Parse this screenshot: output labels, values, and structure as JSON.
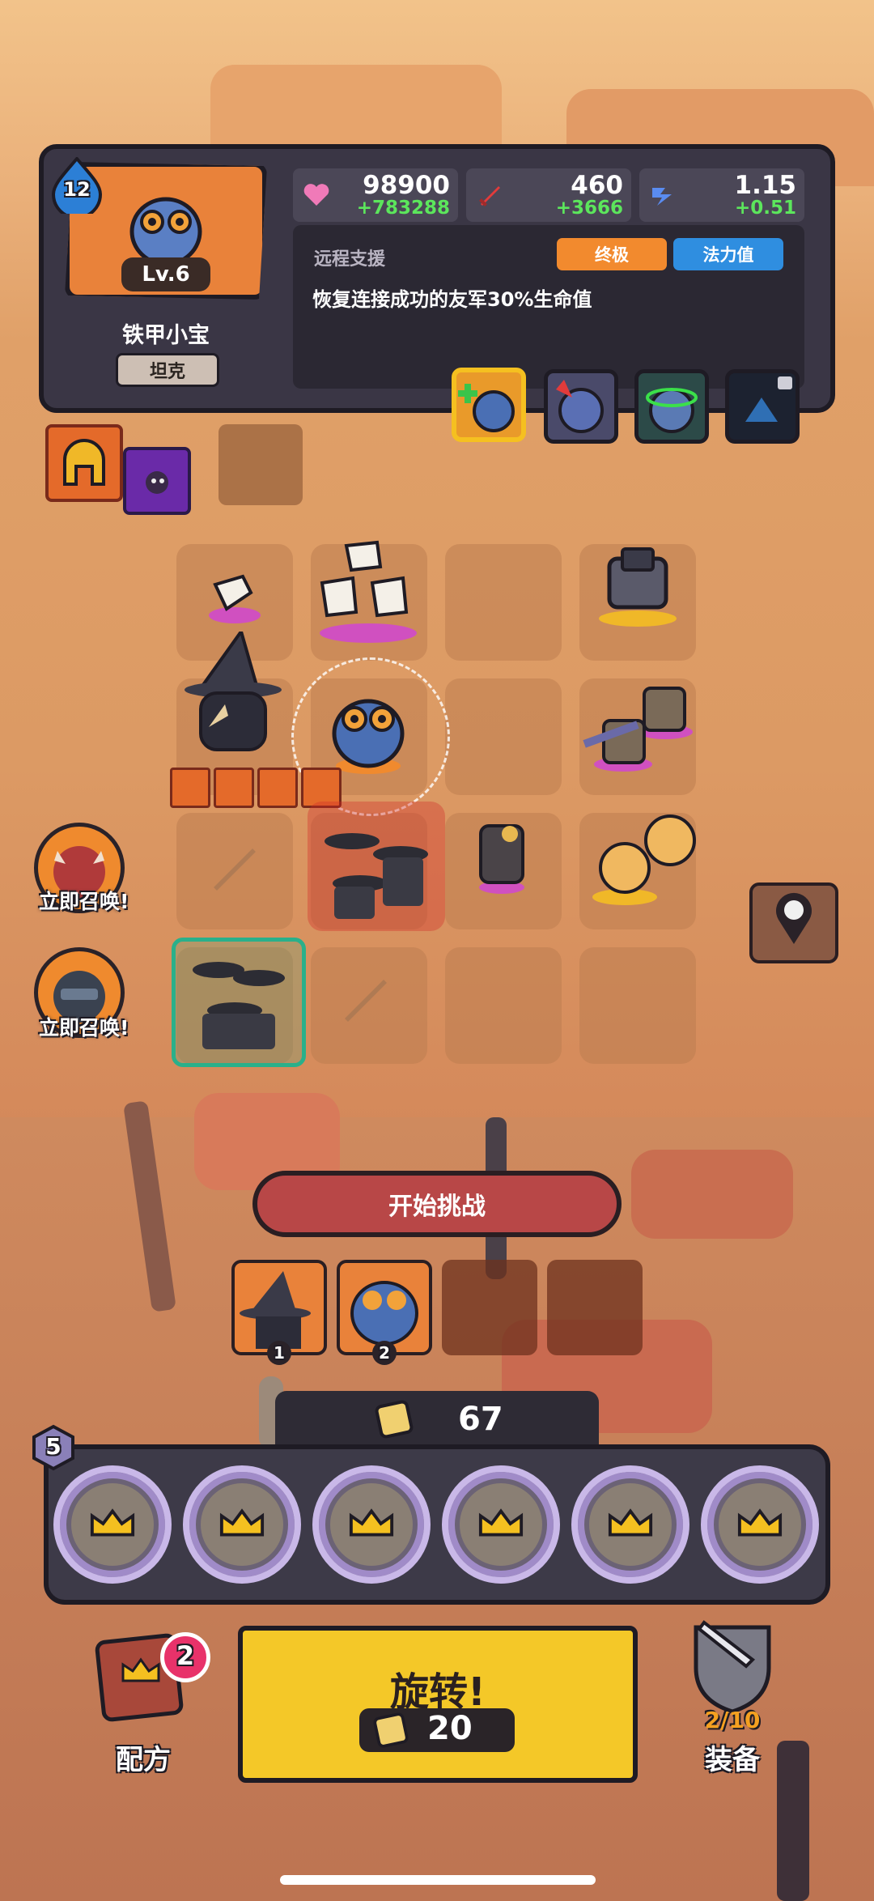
{
  "hero": {
    "star_level": "12",
    "level": "Lv.6",
    "name": "铁甲小宝",
    "role": "坦克"
  },
  "stats": {
    "hp": {
      "value": "98900",
      "delta": "+783288",
      "icon": "heart-icon"
    },
    "attack": {
      "value": "460",
      "delta": "+3666",
      "icon": "sword-icon"
    },
    "speed": {
      "value": "1.15",
      "delta": "+0.51",
      "icon": "speed-icon"
    }
  },
  "skill": {
    "title": "远程支援",
    "tag_tier": "终极",
    "tag_type": "法力值",
    "description": "恢复连接成功的友军30%生命值"
  },
  "summon": {
    "label_1": "立即召唤!",
    "label_2": "立即召唤!"
  },
  "battle": {
    "start_label": "开始挑战",
    "team_numbers": [
      "1",
      "2"
    ]
  },
  "currency": {
    "coins": "67",
    "tray_level": "5"
  },
  "bottom": {
    "recipe_label": "配方",
    "recipe_badge": "2",
    "spin_label": "旋转!",
    "spin_cost": "20",
    "equip_label": "装备",
    "equip_count": "2/10"
  },
  "colors": {
    "panel_bg": "#3a3645",
    "hero_orange": "#e9823a",
    "tag_orange": "#f28a2e",
    "tag_blue": "#2f8ee0",
    "delta_green": "#5ce65c",
    "start_red": "#b84747",
    "spin_yellow": "#f4c828"
  }
}
